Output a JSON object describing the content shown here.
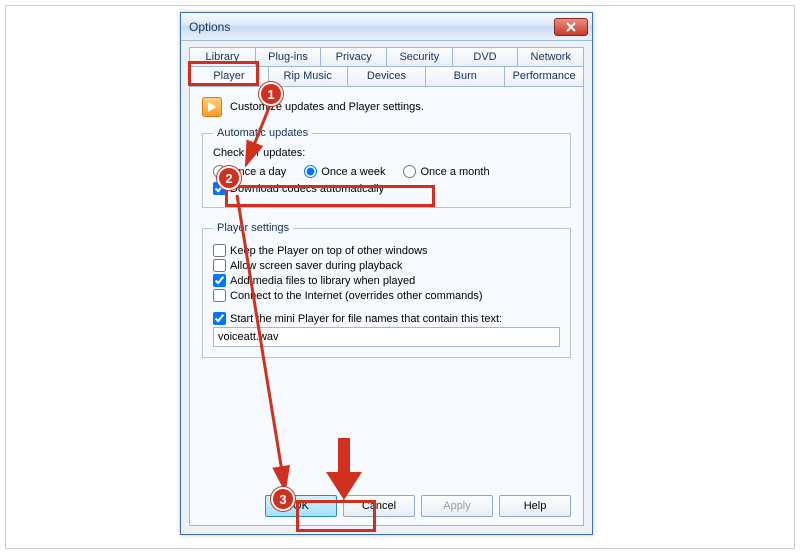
{
  "window": {
    "title": "Options",
    "tabs_row1": [
      "Library",
      "Plug-ins",
      "Privacy",
      "Security",
      "DVD",
      "Network"
    ],
    "tabs_row2": [
      "Player",
      "Rip Music",
      "Devices",
      "Burn",
      "Performance"
    ],
    "active_tab": "Player",
    "intro": "Customize updates and Player settings.",
    "updates": {
      "legend": "Automatic updates",
      "check_label": "Check for updates:",
      "options": [
        "Once a day",
        "Once a week",
        "Once a month"
      ],
      "selected": "Once a week",
      "download_codecs": "Download codecs automatically",
      "download_codecs_checked": true
    },
    "player_settings": {
      "legend": "Player settings",
      "opts": [
        {
          "label": "Keep the Player on top of other windows",
          "checked": false
        },
        {
          "label": "Allow screen saver during playback",
          "checked": false
        },
        {
          "label": "Add media files to library when played",
          "checked": true
        },
        {
          "label": "Connect to the Internet (overrides other commands)",
          "checked": false
        }
      ],
      "mini_label": "Start the mini Player for file names that contain this text:",
      "mini_checked": true,
      "mini_value": "voiceatt.wav"
    },
    "buttons": {
      "ok": "OK",
      "cancel": "Cancel",
      "apply": "Apply",
      "help": "Help"
    }
  },
  "annotations": {
    "steps": [
      "1",
      "2",
      "3"
    ]
  }
}
